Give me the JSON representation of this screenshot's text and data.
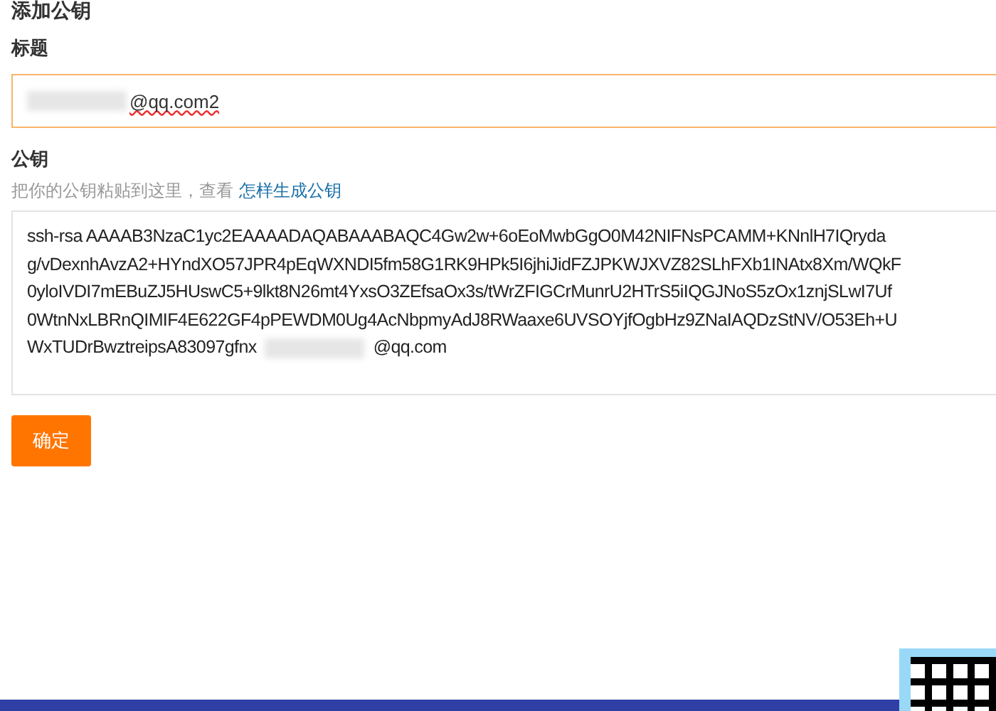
{
  "heading": "添加公钥",
  "title_field": {
    "label": "标题",
    "value": "@qq.com2"
  },
  "key_field": {
    "label": "公钥",
    "hint": "把你的公钥粘贴到这里，查看",
    "hint_link": "怎样生成公钥",
    "lines": [
      "ssh-rsa AAAAB3NzaC1yc2EAAAADAQABAAABAQC4Gw2w+6oEoMwbGgO0M42NIFNsPCAMM+KNnlH7IQryda",
      "g/vDexnhAvzA2+HYndXO57JPR4pEqWXNDI5fm58G1RK9HPk5I6jhiJidFZJPKWJXVZ82SLhFXb1INAtx8Xm/WQkF",
      "0yloIVDI7mEBuZJ5HUswC5+9lkt8N26mt4YxsO3ZEfsaOx3s/tWrZFIGCrMunrU2HTrS5iIQGJNoS5zOx1znjSLwI7Uf",
      "0WtnNxLBRnQIMIF4E622GF4pPEWDM0Ug4AcNbpmyAdJ8RWaaxe6UVSOYjfOgbHz9ZNaIAQDzStNV/O53Eh+U"
    ],
    "last_line_start": "WxTUDrBwztreipsA83097gfnx",
    "last_line_end": "@qq.com"
  },
  "submit": "确定"
}
